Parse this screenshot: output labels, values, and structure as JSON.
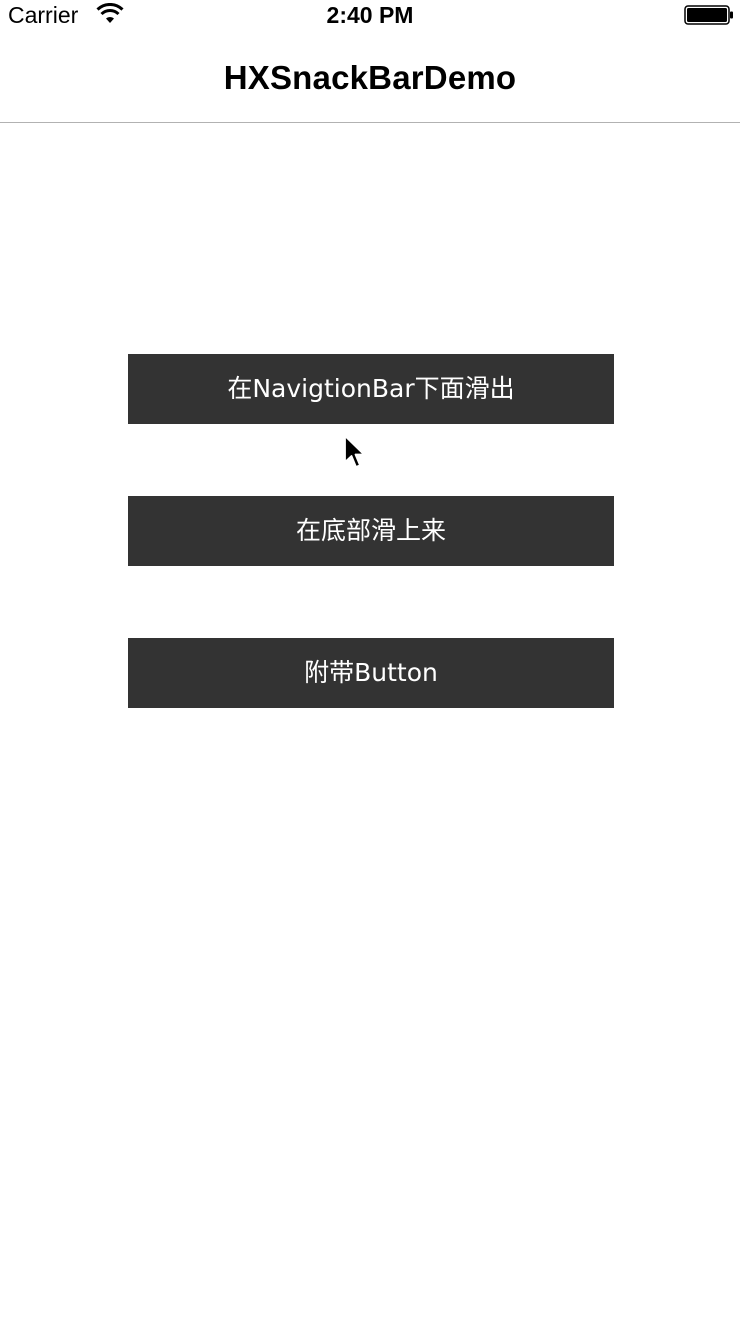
{
  "status_bar": {
    "carrier": "Carrier",
    "time": "2:40 PM",
    "wifi_icon": "wifi-icon",
    "battery_icon": "battery-icon"
  },
  "nav_bar": {
    "title": "HXSnackBarDemo"
  },
  "buttons": [
    {
      "label": "在NavigtionBar下面滑出"
    },
    {
      "label": "在底部滑上来"
    },
    {
      "label": "附带Button"
    }
  ],
  "colors": {
    "background": "#ffffff",
    "button_background": "#333333",
    "button_text": "#ffffff",
    "nav_divider": "#b2b2b2"
  },
  "cursor_icon": "arrow-cursor-icon"
}
